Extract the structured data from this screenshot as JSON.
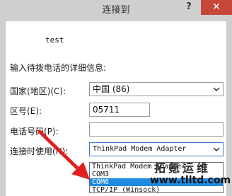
{
  "window": {
    "title": "连接到",
    "help_glyph": "?",
    "close_glyph": "✕"
  },
  "entry_name": "test",
  "details_prompt": "输入待拨电话的详细信息:",
  "fields": {
    "country_label": "国家(地区)(C):",
    "country_value": "中国 (86)",
    "area_code_label": "区号(E):",
    "area_code_value": "05711",
    "phone_label": "电话号码(P):",
    "phone_value": "",
    "connect_using_label": "连接时使用(N):",
    "connect_using_value": "ThinkPad Modem Adapter"
  },
  "dropdown": {
    "options": [
      "ThinkPad Modem Adapter",
      "COM3",
      "COM6",
      "TCP/IP (Winsock)"
    ],
    "selected_index": 2
  },
  "watermark": {
    "text": "拓氪运维",
    "url": "www.tlltd.com"
  },
  "colors": {
    "title_bar": "#cfcfcf",
    "close_button": "#c7463a",
    "selection": "#1e8ae0",
    "annotation_arrow": "#e02020"
  },
  "icons": {
    "dropdown_arrow": "chevron-down-icon",
    "annotation": "red-arrow-icon"
  }
}
